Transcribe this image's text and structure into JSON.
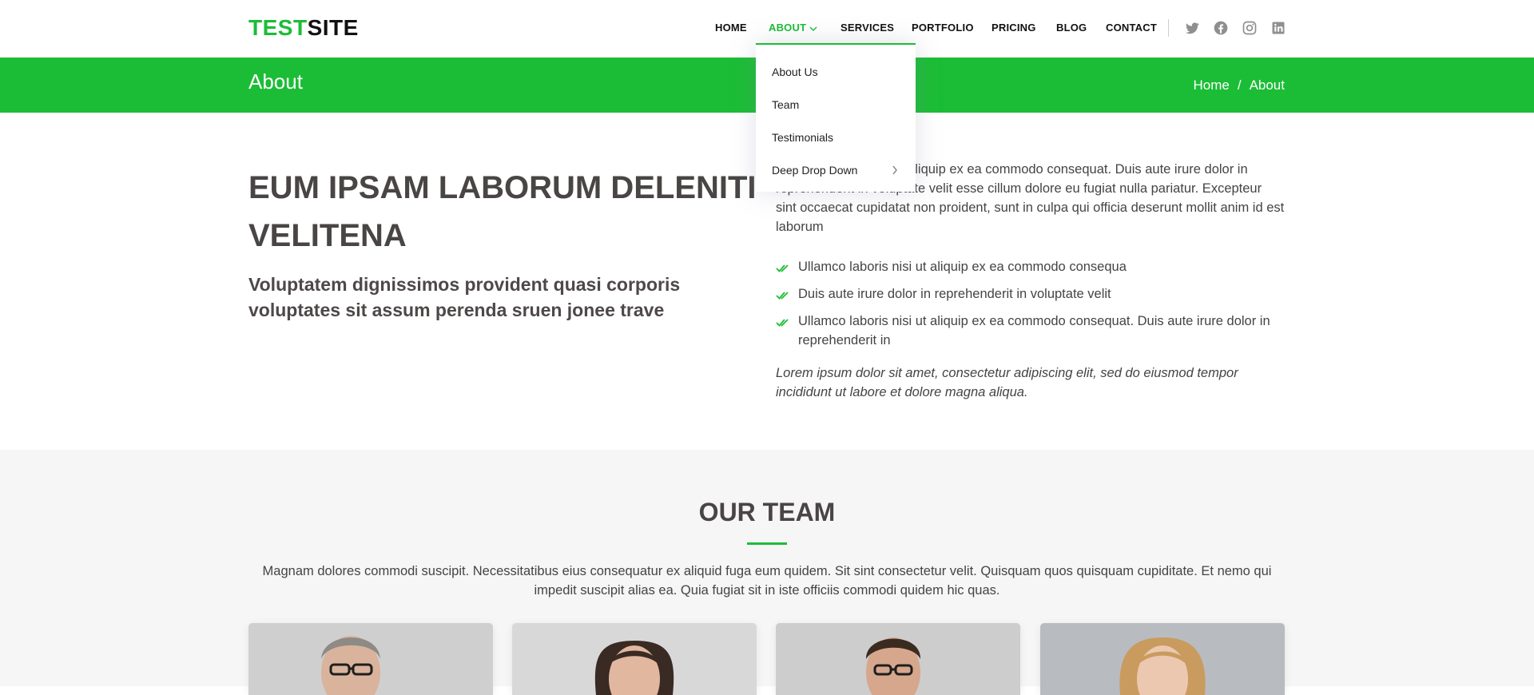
{
  "brand": {
    "part1": "TEST",
    "part2": "SITE",
    "accent_color": "#1bbd36"
  },
  "nav": {
    "items": [
      {
        "label": "HOME"
      },
      {
        "label": "ABOUT",
        "active": true
      },
      {
        "label": "SERVICES"
      },
      {
        "label": "PORTFOLIO"
      },
      {
        "label": "PRICING"
      },
      {
        "label": "BLOG"
      },
      {
        "label": "CONTACT"
      }
    ],
    "social_icons": [
      "twitter-icon",
      "facebook-icon",
      "instagram-icon",
      "linkedin-icon"
    ]
  },
  "dropdown": {
    "items": [
      {
        "label": "About Us"
      },
      {
        "label": "Team"
      },
      {
        "label": "Testimonials"
      },
      {
        "label": "Deep Drop Down",
        "has_submenu": true
      }
    ]
  },
  "titlebar": {
    "title": "About",
    "breadcrumb": {
      "home": "Home",
      "separator": "/",
      "current": "About"
    }
  },
  "about": {
    "heading": "EUM IPSAM LABORUM DELENITI VELITENA",
    "subheading": "Voluptatem dignissimos provident quasi corporis voluptates sit assum perenda sruen jonee trave",
    "paragraph": "Ullamco laboris nisi ut aliquip ex ea commodo consequat. Duis aute irure dolor in reprehenderit in voluptate velit esse cillum dolore eu fugiat nulla pariatur. Excepteur sint occaecat cupidatat non proident, sunt in culpa qui officia deserunt mollit anim id est laborum",
    "list": [
      "Ullamco laboris nisi ut aliquip ex ea commodo consequa",
      "Duis aute irure dolor in reprehenderit in voluptate velit",
      "Ullamco laboris nisi ut aliquip ex ea commodo consequat. Duis aute irure dolor in reprehenderit in"
    ],
    "italic_note": "Lorem ipsum dolor sit amet, consectetur adipiscing elit, sed do eiusmod tempor incididunt ut labore et dolore magna aliqua."
  },
  "team": {
    "title": "OUR TEAM",
    "description": "Magnam dolores commodi suscipit. Necessitatibus eius consequatur ex aliquid fuga eum quidem. Sit sint consectetur velit. Quisquam quos quisquam cupiditate. Et nemo qui impedit suscipit alias ea. Quia fugiat sit in iste officiis commodi quidem hic quas.",
    "members": [
      {
        "photo": "member-photo-1"
      },
      {
        "photo": "member-photo-2"
      },
      {
        "photo": "member-photo-3"
      },
      {
        "photo": "member-photo-4"
      }
    ]
  }
}
